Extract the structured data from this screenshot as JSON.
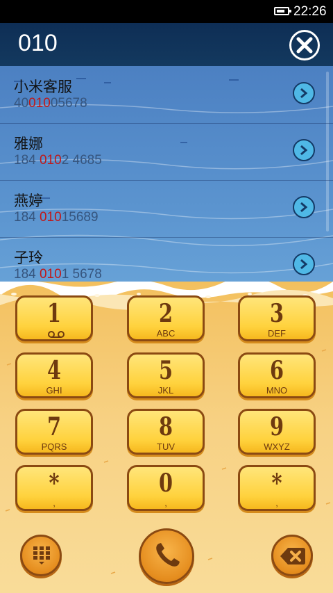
{
  "status_bar": {
    "time": "22:26",
    "battery_level": 0.75
  },
  "search": {
    "query": "010"
  },
  "results": [
    {
      "name": "小米客服",
      "number_pre": "40",
      "number_match": "010",
      "number_post": "05678"
    },
    {
      "name": "雅娜",
      "number_pre": "184 ",
      "number_match": "010",
      "number_post": "2 4685"
    },
    {
      "name": "燕婷",
      "number_pre": "184 ",
      "number_match": "010",
      "number_post": "15689"
    },
    {
      "name": "子玲",
      "number_pre": "184 ",
      "number_match": "010",
      "number_post": "1 5678"
    }
  ],
  "keypad": [
    {
      "digit": "1",
      "letters": "",
      "voicemail": true
    },
    {
      "digit": "2",
      "letters": "ABC"
    },
    {
      "digit": "3",
      "letters": "DEF"
    },
    {
      "digit": "4",
      "letters": "GHI"
    },
    {
      "digit": "5",
      "letters": "JKL"
    },
    {
      "digit": "6",
      "letters": "MNO"
    },
    {
      "digit": "7",
      "letters": "PQRS"
    },
    {
      "digit": "8",
      "letters": "TUV"
    },
    {
      "digit": "9",
      "letters": "WXYZ"
    },
    {
      "digit": "*",
      "letters": ","
    },
    {
      "digit": "0",
      "letters": ","
    },
    {
      "digit": "*",
      "letters": ","
    }
  ],
  "icons": {
    "battery": "battery-icon",
    "close": "close-icon",
    "arrow": "chevron-right-icon",
    "keypad_toggle": "keypad-grid-icon",
    "call": "phone-icon",
    "delete": "backspace-icon"
  },
  "colors": {
    "header_bg": "#0e2e55",
    "water": "#5b94cf",
    "sand": "#f7d183",
    "key_fill": "#ffd23d",
    "key_border": "#8b4a12",
    "match_highlight": "#c01818"
  }
}
